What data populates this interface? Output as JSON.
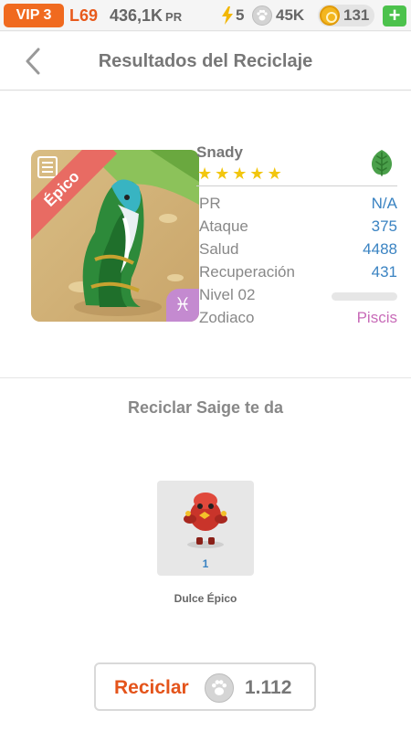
{
  "topbar": {
    "vip": "VIP 3",
    "level": "L69",
    "pr_value": "436,1K",
    "pr_label": "PR",
    "energy": "5",
    "food": "45K",
    "gold": "131",
    "add_label": "+"
  },
  "header": {
    "title": "Resultados del Reciclaje",
    "back_icon": "chevron-left-icon"
  },
  "monster": {
    "name": "Snady",
    "rarity": "Épico",
    "stars": 5,
    "element_icon": "leaf-icon",
    "zodiac_icon": "pisces-icon",
    "stats": [
      {
        "label": "PR",
        "value": "N/A"
      },
      {
        "label": "Ataque",
        "value": "375"
      },
      {
        "label": "Salud",
        "value": "4488"
      },
      {
        "label": "Recuperación",
        "value": "431"
      },
      {
        "label": "Nivel 02",
        "value": ""
      },
      {
        "label": "Zodiaco",
        "value": "Piscis"
      }
    ]
  },
  "recycle": {
    "title": "Reciclar Saige te da",
    "reward": {
      "quantity": "1",
      "name": "Dulce Épico"
    },
    "button_label": "Reciclar",
    "button_cost": "1.112"
  },
  "colors": {
    "accent": "#f06a1f",
    "stat_value": "#3a83c2",
    "zodiac": "#c86bb8",
    "add_button": "#4cc24c"
  }
}
